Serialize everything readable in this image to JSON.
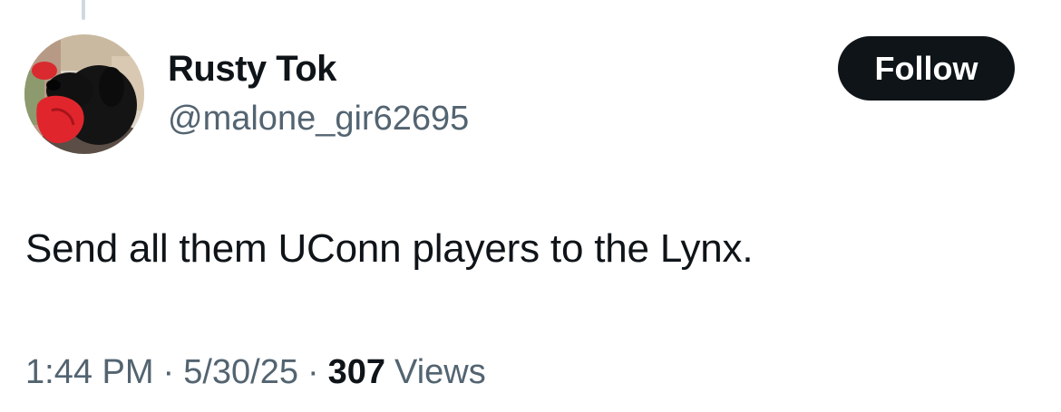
{
  "author": {
    "display_name": "Rusty Tok",
    "handle": "@malone_gir62695",
    "avatar_icon": "dog-avatar-icon"
  },
  "actions": {
    "follow_label": "Follow"
  },
  "tweet": {
    "text": "Send all them UConn players to the Lynx."
  },
  "meta": {
    "time": "1:44 PM",
    "separator": "·",
    "date": "5/30/25",
    "views_count": "307",
    "views_label": "Views"
  },
  "colors": {
    "primary_text": "#0f1419",
    "secondary_text": "#536471",
    "button_bg": "#0f1419",
    "button_text": "#ffffff",
    "thread_line": "#cfd9de"
  }
}
